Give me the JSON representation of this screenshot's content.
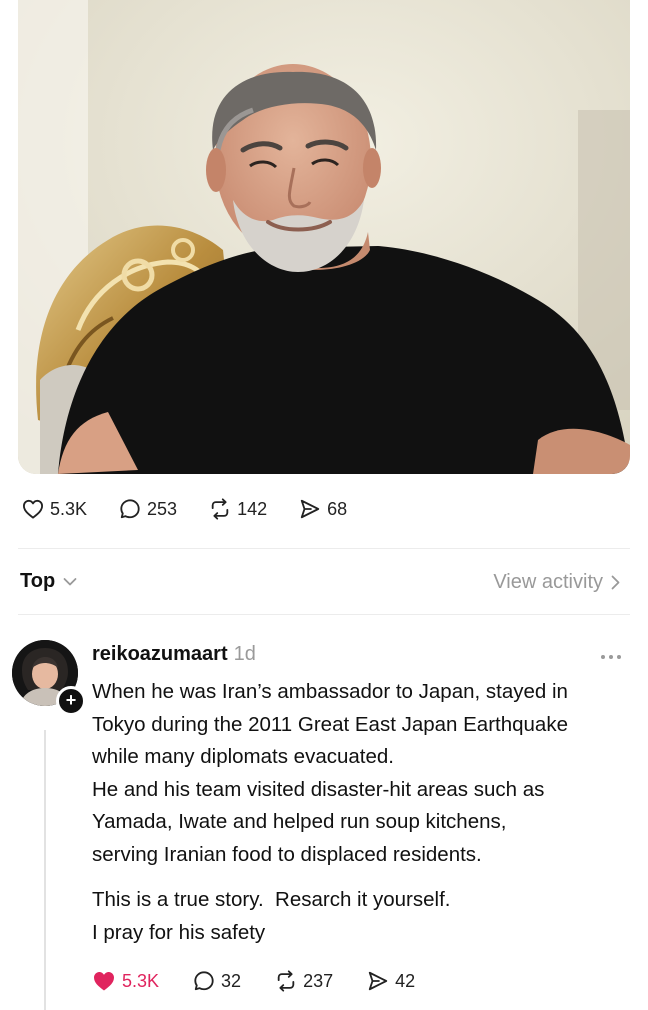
{
  "post": {
    "image": {
      "alt": "Portrait photo of a smiling grey-haired man in a black t-shirt seated in an ornate gilded chair"
    },
    "actions": {
      "likes": "5.3K",
      "replies": "253",
      "reposts": "142",
      "shares": "68"
    }
  },
  "sort": {
    "label": "Top",
    "view_activity": "View activity"
  },
  "comment": {
    "username": "reikoazumaart",
    "timestamp": "1d",
    "more_icon": "more-horizontal-icon",
    "lines": [
      "When he was Iran’s ambassador to Japan, stayed in",
      "Tokyo during the 2011 Great East Japan Earthquake",
      "while many diplomats evacuated.",
      "He and his team visited disaster-hit areas such as",
      "Yamada, Iwate and helped run soup kitchens,",
      "serving Iranian food to displaced residents."
    ],
    "lines2": [
      "This is a true story.  Resarch it yourself.",
      "I pray for his safety"
    ],
    "actions": {
      "likes": "5.3K",
      "liked": true,
      "replies": "32",
      "reposts": "237",
      "shares": "42"
    }
  },
  "colors": {
    "liked_heart": "#e0245e",
    "muted_text": "#999999",
    "divider": "#ececec"
  }
}
